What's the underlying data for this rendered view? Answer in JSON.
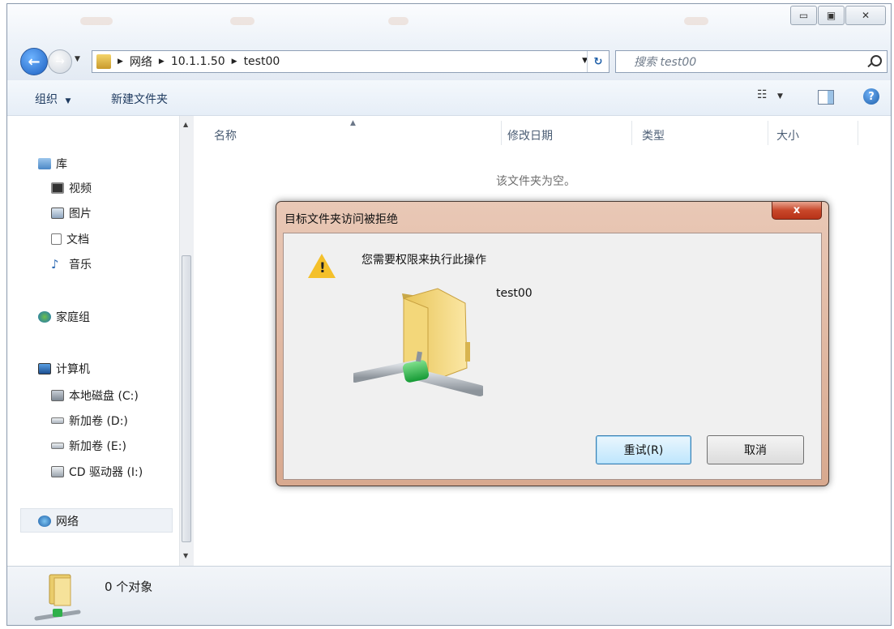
{
  "window": {
    "minimize_icon": "minimize-icon",
    "maximize_icon": "maximize-icon",
    "close_icon": "close-icon"
  },
  "address": {
    "crumbs": [
      "网络",
      "10.1.1.50",
      "test00"
    ],
    "search_placeholder": "搜索 test00"
  },
  "toolbar": {
    "organize": "组织",
    "new_folder": "新建文件夹"
  },
  "nav": {
    "library": "库",
    "videos": "视频",
    "pictures": "图片",
    "documents": "文档",
    "music": "音乐",
    "homegroup": "家庭组",
    "computer": "计算机",
    "drive_c": "本地磁盘 (C:)",
    "drive_d": "新加卷 (D:)",
    "drive_e": "新加卷 (E:)",
    "drive_cd": "CD 驱动器 (I:)",
    "network": "网络"
  },
  "columns": [
    "名称",
    "修改日期",
    "类型",
    "大小"
  ],
  "empty_text": "该文件夹为空。",
  "status": {
    "count": "0 个对象"
  },
  "dialog": {
    "title": "目标文件夹访问被拒绝",
    "close_label": "x",
    "message": "您需要权限来执行此操作",
    "item_name": "test00",
    "retry": "重试(R)",
    "cancel": "取消"
  }
}
